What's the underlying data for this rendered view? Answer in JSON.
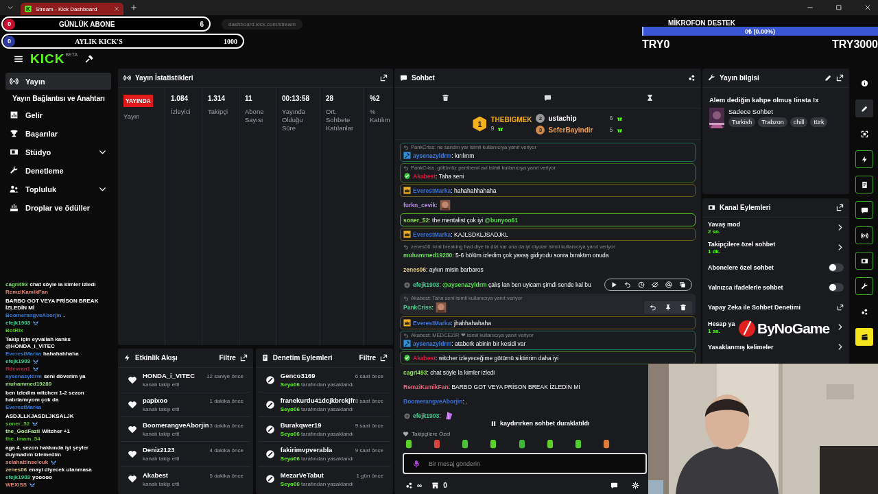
{
  "browser": {
    "tab_title": "Stream - Kick Dashboard",
    "url": "dashboard.kick.com/stream"
  },
  "goals": [
    {
      "kind": "subs",
      "current": "0",
      "label": "GÜNLÜK ABONE",
      "target": "6",
      "color": "#c8102e"
    },
    {
      "kind": "kicks",
      "current": "0",
      "label": "AYLIK KICK'S",
      "target": "1000",
      "color": "#2b3a9c"
    }
  ],
  "mic_goal": {
    "title": "MİKROFON DESTEK",
    "reading": "0₺ (0.00%)",
    "level": 0,
    "min": "TRY0",
    "max": "TRY3000"
  },
  "header": {
    "logo": "KICK",
    "logo_tag": "BETA"
  },
  "sidebar": {
    "items": [
      {
        "label": "Yayın",
        "selected": true,
        "expandable": false,
        "children": [
          {
            "label": "Yayın Bağlantısı ve Anahtarı",
            "selected": false
          }
        ]
      },
      {
        "label": "Gelir",
        "selected": false,
        "expandable": false
      },
      {
        "label": "Başarılar",
        "selected": false,
        "expandable": false
      },
      {
        "label": "Stüdyo",
        "selected": false,
        "expandable": true
      },
      {
        "label": "Denetleme",
        "selected": false,
        "expandable": false
      },
      {
        "label": "Topluluk",
        "selected": false,
        "expandable": true
      },
      {
        "label": "Droplar ve ödüller",
        "selected": false,
        "expandable": false
      }
    ]
  },
  "overlay_chat": [
    {
      "user": "cagri493",
      "color": "#7fe06a",
      "text": "chat söyle la kimler izledi"
    },
    {
      "user": "RemziKamikFan",
      "color": "#e08a7a",
      "text": "BARBO GOT VEYA PRİSON BREAK İZLEDİN Mİ"
    },
    {
      "user": "BoomerangveAborjin",
      "color": "#3a78d0",
      "text": "."
    },
    {
      "user": "efejk1903",
      "color": "#43d08f",
      "emote": true
    },
    {
      "user": "BotRix",
      "color": "#53c418",
      "text": "Takip için eyvallah kanks @HONDA_i_VITEC"
    },
    {
      "user": "EverestMarka",
      "color": "#3a78d0",
      "text": "hahahahhaha"
    },
    {
      "user": "efejk1903",
      "color": "#43d08f",
      "emote": true
    },
    {
      "user": "ffdevran1",
      "color": "#b0283f",
      "emote": true
    },
    {
      "user": "aysenazyldrm",
      "color": "#3a78d0",
      "text": "seni döverim ya"
    },
    {
      "user": "muhammed19280",
      "color": "#9be07a",
      "text": "ben izledim witcherı 1-2 sezon hatırlamıyom çok da"
    },
    {
      "user": "EverestMarka",
      "color": "#3a78d0",
      "text": "ASDJLLKJASDLJKSALJK"
    },
    {
      "user": "soner_52",
      "color": "#53c418",
      "emote": true
    },
    {
      "user": "the_GodFazil",
      "color": "#b8e89a",
      "text": "Witcher +1"
    },
    {
      "user": "the_imam_54",
      "color": "#53c418",
      "text": "aga 4. sezon hakkında iyi şeyler duymadım izlemedim"
    },
    {
      "user": "selahattinselcuk",
      "color": "#e08a7a",
      "emote": true
    },
    {
      "user": "zenes06",
      "color": "#e8cf8a",
      "text": "enayi diyecek utanmasa"
    },
    {
      "user": "efejk1903",
      "color": "#43d08f",
      "text": "yooooo"
    },
    {
      "user": "WEXISS",
      "color": "#e08a7a",
      "emote": true
    }
  ],
  "stats": {
    "title": "Yayın İstatistikleri",
    "live_badge": "YAYINDA",
    "live_label": "Yayın",
    "items": [
      {
        "value": "1.084",
        "label": "İzleyici"
      },
      {
        "value": "1.314",
        "label": "Takipçi"
      },
      {
        "value": "11",
        "label": "Abone Sayısı"
      },
      {
        "value": "00:13:58",
        "label": "Yayında Olduğu Süre"
      },
      {
        "value": "28",
        "label": "Ort. Sohbete Katılanlar"
      },
      {
        "value": "%2",
        "label": "% Katılım"
      }
    ]
  },
  "activity": {
    "title": "Etkinlik Akışı",
    "filter": "Filtre",
    "events": [
      {
        "user": "HONDA_i_VITEC",
        "time": "12 saniye önce",
        "action": "kanalı takip etti"
      },
      {
        "user": "papixoo",
        "time": "1 dakika önce",
        "action": "kanalı takip etti"
      },
      {
        "user": "BoomerangveAborjin",
        "time": "3 dakika önce",
        "action": "kanalı takip etti"
      },
      {
        "user": "Deniz2123",
        "time": "4 dakika önce",
        "action": "kanalı takip etti"
      },
      {
        "user": "Akabest",
        "time": "5 dakika önce",
        "action": "kanalı takip etti"
      }
    ]
  },
  "moderation": {
    "title": "Denetim Eylemleri",
    "filter": "Filtre",
    "actions": [
      {
        "user": "Genco3169",
        "time": "6 saat önce",
        "moderator": "Seyo06",
        "action": "tarafından yasaklandı"
      },
      {
        "user": "franekurdu41dcjkbrckjfr",
        "time": "8 saat önce",
        "moderator": "Seyo06",
        "action": "tarafından yasaklandı"
      },
      {
        "user": "Burakqwer19",
        "time": "9 saat önce",
        "moderator": "Seyo06",
        "action": "tarafından yasaklandı"
      },
      {
        "user": "fakirimvpverabla",
        "time": "9 saat önce",
        "moderator": "Seyo06",
        "action": "tarafından yasaklandı"
      },
      {
        "user": "MezarVeTabut",
        "time": "1 gün önce",
        "moderator": "Seyo06",
        "action": "tarafından yasaklandı"
      }
    ]
  },
  "chat": {
    "title": "Sohbet",
    "leaderboard": [
      {
        "rank": "1",
        "name": "THEBIGMEK",
        "count": "9",
        "color": "#f2b01e",
        "name_style": {
          "color": "#f2b01e"
        }
      },
      {
        "rank": "2",
        "name": "ustachip",
        "count": "6",
        "color": "#9a9a9a",
        "name_style": {
          "color": "#ffffff"
        }
      },
      {
        "rank": "3",
        "name": "SeferBayindir",
        "count": "5",
        "color": "#d08a4a",
        "name_style": {
          "color": "#f0a050"
        }
      }
    ],
    "messages": [
      {
        "reply": "PankCriss: ne sandın yar isimli kullanıcıya yanıt veriyor",
        "badge": {
          "kind": "mod"
        },
        "user": "aysenazyldrm",
        "color": "#3d7be0",
        "parts": [
          {
            "text": ": kırılırım"
          }
        ],
        "frame": {
          "color": "#1f6b5e"
        }
      },
      {
        "reply": "PankCriss: götümüz pembemi avi isimli kullanıcıya yanıt veriyor",
        "badge": {
          "kind": "verified"
        },
        "user": "Akabest",
        "color": "#e0153e",
        "parts": [
          {
            "text": ": Taha seni"
          }
        ],
        "frame": {
          "color": "#3f6a1e"
        }
      },
      {
        "badge": {
          "kind": "crown"
        },
        "user": "EverestMarka",
        "color": "#3a6fd6",
        "parts": [
          {
            "text": ": hahahahhahaha"
          }
        ],
        "frame": {
          "color": "#6b5a1a"
        }
      },
      {
        "user": "furkn_cevik",
        "color": "#b58ce6",
        "parts": [
          {
            "text": ":"
          }
        ],
        "emote": true
      },
      {
        "user": "soner_52",
        "color": "#8be04a",
        "parts": [
          {
            "text": ": the mentalist çok iyi "
          },
          {
            "text": "@bunyoo61",
            "mention": true
          }
        ],
        "frame": {
          "color": "#53c418"
        }
      },
      {
        "badge": {
          "kind": "crown"
        },
        "user": "EverestMarka",
        "color": "#3a6fd6",
        "parts": [
          {
            "text": ": KAJLSDKLJSADJKL"
          }
        ],
        "frame": {
          "color": "#6b5a1a"
        }
      },
      {
        "reply": "zenes06: kral breaking bad diye bı dizi var ona da iyi diyolar isimli kullanıcıya yanıt veriyor",
        "user": "muhammed19280",
        "color": "#6bdc5a",
        "parts": [
          {
            "text": ": 5-6 bölüm izledim çok yavaş gidiyodu sonra bıraktım onuda"
          }
        ]
      },
      {
        "user": "zenes06",
        "color": "#e8cf8a",
        "parts": [
          {
            "text": ": aykırı misin barbaros"
          }
        ]
      },
      {
        "badge": {
          "kind": "gift"
        },
        "user": "efejk1903",
        "color": "#43d08f",
        "parts": [
          {
            "text": ": "
          },
          {
            "text": "@aysenazyldrm",
            "mention": true
          },
          {
            "text": " çalış lan ben uyicam şimdi sende kal bu"
          }
        ],
        "toolbar": true
      },
      {
        "reply": "Akabest: Taha seni isimli kullanıcıya yanıt veriyor",
        "user": "PankCriss",
        "color": "#4fc98a",
        "parts": [
          {
            "text": ":"
          }
        ],
        "emote": true,
        "hovered": true
      },
      {
        "badge": {
          "kind": "crown"
        },
        "user": "EverestMarka",
        "color": "#3a6fd6",
        "parts": [
          {
            "text": ": jhahhahahaha"
          }
        ],
        "frame": {
          "color": "#6b5a1a"
        }
      },
      {
        "reply": "Akabest: MEDCEZİR ❤ isimli kullanıcıya yanıt veriyor",
        "badge": {
          "kind": "mod"
        },
        "user": "aysenazyldrm",
        "color": "#3d7be0",
        "parts": [
          {
            "text": ": ataberk abinin bir kesidi var"
          }
        ],
        "frame": {
          "color": "#1f6b5e"
        }
      },
      {
        "badge": {
          "kind": "verified"
        },
        "user": "Akabest",
        "color": "#e0153e",
        "parts": [
          {
            "text": ": witcher izleyeceğime götümü siktiririm daha iyi"
          }
        ],
        "frame": {
          "color": "#3f6a1e"
        }
      },
      {
        "user": "cagri493",
        "color": "#8be04a",
        "parts": [
          {
            "text": ": chat söyle la kimler izledi"
          }
        ]
      },
      {
        "user": "RemziKamikFan",
        "color": "#e0657a",
        "parts": [
          {
            "text": ": BARBO GOT VEYA PRİSON BREAK İZLEDİN Mİ"
          }
        ]
      },
      {
        "user": "BoomerangveAborjin",
        "color": "#3a6fd6",
        "parts": [
          {
            "text": ": ."
          }
        ]
      },
      {
        "badge": {
          "kind": "gift"
        },
        "user": "efejk1903",
        "color": "#43d08f",
        "parts": [
          {
            "text": ":"
          }
        ],
        "emote": true
      }
    ],
    "paused_notice": "kaydırırken sohbet duraklatıldı",
    "followers_only": "Takipçilere Özel",
    "emote_bar": [
      {
        "color": "#5bd12a"
      },
      {
        "color": "#d8453a"
      },
      {
        "color": "#4cc23a"
      },
      {
        "color": "#5bd12a"
      },
      {
        "color": "#3fb83a"
      },
      {
        "color": "#5bd12a"
      },
      {
        "color": "#4fcf2f"
      },
      {
        "color": "#e07a3a"
      }
    ],
    "input": {
      "placeholder": "Bir mesaj gönderin"
    },
    "footer": {
      "drops": "∞",
      "points": "0"
    }
  },
  "stream_info": {
    "title": "Yayın bilgisi",
    "stream_title": "Alem dediğin kahpe olmuş !insta !x",
    "category": "Sadece Sohbet",
    "tags": [
      "Turkish",
      "Trabzon",
      "chill",
      "türk"
    ]
  },
  "channel_actions": {
    "title": "Kanal Eylemleri",
    "items": [
      {
        "kind": "link",
        "label": "Yavaş mod",
        "value": "2 sn."
      },
      {
        "kind": "link",
        "label": "Takipçilere özel sohbet",
        "value": "1 dk."
      },
      {
        "kind": "toggle",
        "label": "Abonelere özel sohbet",
        "on": false
      },
      {
        "kind": "toggle",
        "label": "Yalnızca ifadelerle sohbet",
        "on": false
      },
      {
        "kind": "external",
        "label": "Yapay Zeka ile Sohbet Denetimi"
      },
      {
        "kind": "link",
        "label": "Hesap ya",
        "value": "1 sa."
      },
      {
        "kind": "link",
        "label": "Yasaklanmış kelimeler"
      }
    ]
  },
  "sponsor_logo": "ByNoGame",
  "rail": [
    {
      "selected": false,
      "pinned": false
    },
    {
      "selected": true,
      "pinned": false
    },
    {
      "selected": false,
      "pinned": false
    },
    {
      "selected": false,
      "pinned": true
    },
    {
      "selected": false,
      "pinned": true
    },
    {
      "selected": false,
      "pinned": true
    },
    {
      "selected": false,
      "pinned": true
    },
    {
      "selected": false,
      "pinned": true
    },
    {
      "selected": false,
      "pinned": true
    },
    {
      "selected": false,
      "pinned": false
    },
    {
      "selected": false,
      "pinned": false
    }
  ]
}
